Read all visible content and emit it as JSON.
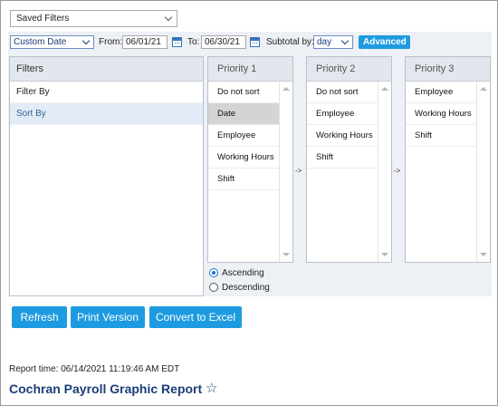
{
  "saved_filters": {
    "value": "Saved Filters"
  },
  "toolbar": {
    "date_range_type": "Custom Date",
    "from_label": "From:",
    "from_value": "06/01/21",
    "to_label": "To:",
    "to_value": "06/30/21",
    "subtotal_label": "Subtotal by:",
    "subtotal_value": "day",
    "advanced_label": "Advanced <"
  },
  "filters_panel": {
    "header": "Filters",
    "items": [
      "Filter By",
      "Sort By"
    ],
    "selected_item": "Sort By"
  },
  "priorities": [
    {
      "header": "Priority 1",
      "items": [
        "Do not sort",
        "Date",
        "Employee",
        "Working Hours",
        "Shift"
      ],
      "selected": "Date"
    },
    {
      "header": "Priority 2",
      "items": [
        "Do not sort",
        "Employee",
        "Working Hours",
        "Shift"
      ]
    },
    {
      "header": "Priority 3",
      "items": [
        "Employee",
        "Working Hours",
        "Shift"
      ]
    }
  ],
  "move_arrow": "->",
  "sort_order": {
    "options": [
      "Ascending",
      "Descending"
    ],
    "selected": "Ascending"
  },
  "buttons": {
    "refresh": "Refresh",
    "print_version": "Print Version",
    "convert_to_excel": "Convert to Excel"
  },
  "report": {
    "time": "Report time: 06/14/2021 11:19:46 AM EDT",
    "title": "Cochran Payroll Graphic Report"
  },
  "colors": {
    "accent": "#1e9be0",
    "title": "#1b3d79",
    "panel_bg": "#edf0f4"
  },
  "icons": [
    "chevron-down-icon",
    "calendar-icon",
    "arrow-up-icon",
    "arrow-down-icon",
    "radio-icon",
    "star-icon"
  ]
}
